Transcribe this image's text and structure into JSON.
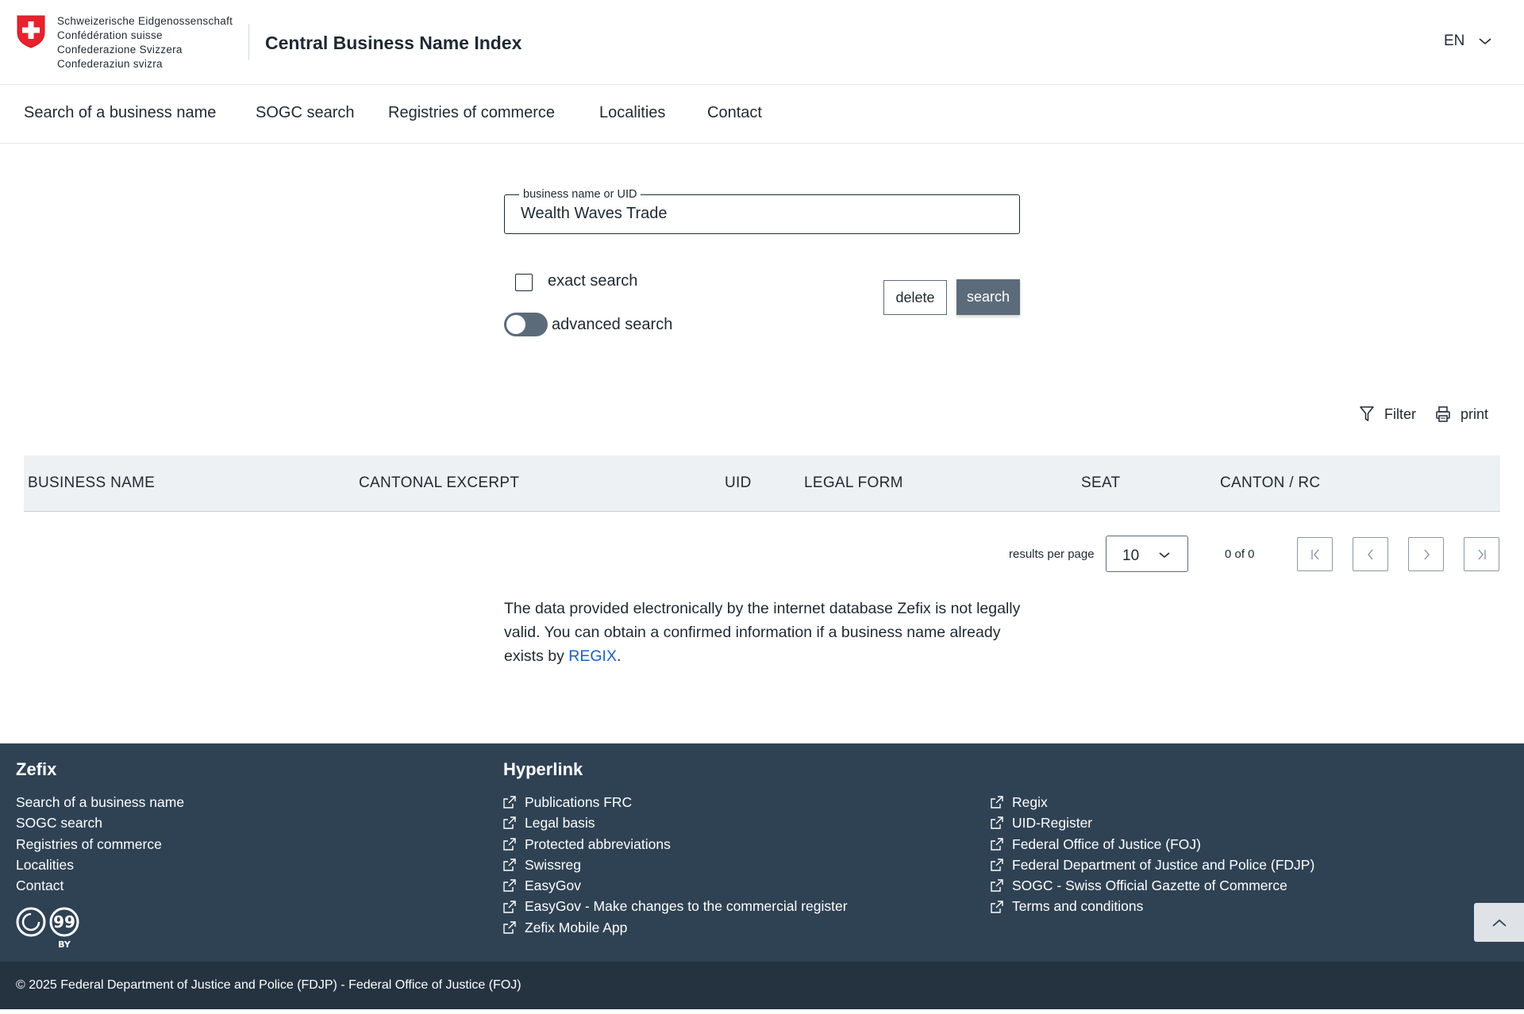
{
  "header": {
    "confederation_lines": [
      "Schweizerische Eidgenossenschaft",
      "Confédération suisse",
      "Confederazione Svizzera",
      "Confederaziun svizra"
    ],
    "title": "Central Business Name Index",
    "language": "EN"
  },
  "nav": {
    "items": [
      "Search of a business name",
      "SOGC search",
      "Registries of commerce",
      "Localities",
      "Contact"
    ]
  },
  "search": {
    "field_label": "business name or UID",
    "field_value": "Wealth Waves Trade",
    "exact_search_label": "exact search",
    "exact_search_checked": false,
    "advanced_search_label": "advanced search",
    "advanced_search_enabled": false,
    "delete_label": "delete",
    "search_label": "search"
  },
  "tools": {
    "filter_label": "Filter",
    "print_label": "print"
  },
  "table": {
    "columns": [
      "BUSINESS NAME",
      "CANTONAL EXCERPT",
      "UID",
      "LEGAL FORM",
      "SEAT",
      "CANTON / RC"
    ],
    "rows": []
  },
  "pagination": {
    "results_per_page_label": "results per page",
    "results_per_page_value": "10",
    "page_count": "0 of 0",
    "first_symbol": "|<",
    "prev_symbol": "<",
    "next_symbol": ">",
    "last_symbol": ">|"
  },
  "disclaimer": {
    "text": "The data provided electronically by the internet database Zefix is not legally valid. You can obtain a confirmed information if a business name already exists by ",
    "link_text": "REGIX",
    "suffix": "."
  },
  "footer": {
    "zefix_heading": "Zefix",
    "zefix_links": [
      "Search of a business name",
      "SOGC search",
      "Registries of commerce",
      "Localities",
      "Contact"
    ],
    "hyperlink_heading": "Hyperlink",
    "hyperlinks_col1": [
      "Publications FRC",
      "Legal basis",
      "Protected abbreviations",
      "Swissreg",
      "EasyGov",
      "EasyGov - Make changes to the commercial register",
      "Zefix Mobile App"
    ],
    "hyperlinks_col2": [
      "Regix",
      "UID-Register",
      "Federal Office of Justice (FOJ)",
      "Federal Department of Justice and Police (FDJP)",
      "SOGC - Swiss Official Gazette of Commerce",
      "Terms and conditions"
    ],
    "license_badge": "BY",
    "copyright": "© 2025 Federal Department of Justice and Police (FDJP) - Federal Office of Justice (FOJ)"
  },
  "colors": {
    "footer_bg": "#2f4254",
    "copyright_bg": "#253341",
    "primary_button": "#5c6b7a",
    "table_header_bg": "#eef1f4",
    "link": "#1f5fbf",
    "swiss_red": "#e8212e"
  },
  "icons": {
    "coat_of_arms": "swiss-coat-of-arms-icon",
    "language_dropdown": "chevron-down-icon",
    "filter": "filter-funnel-icon",
    "print": "printer-icon",
    "external_link": "external-link-icon",
    "back_to_top": "chevron-up-icon",
    "license": "creative-commons-by-icon"
  }
}
